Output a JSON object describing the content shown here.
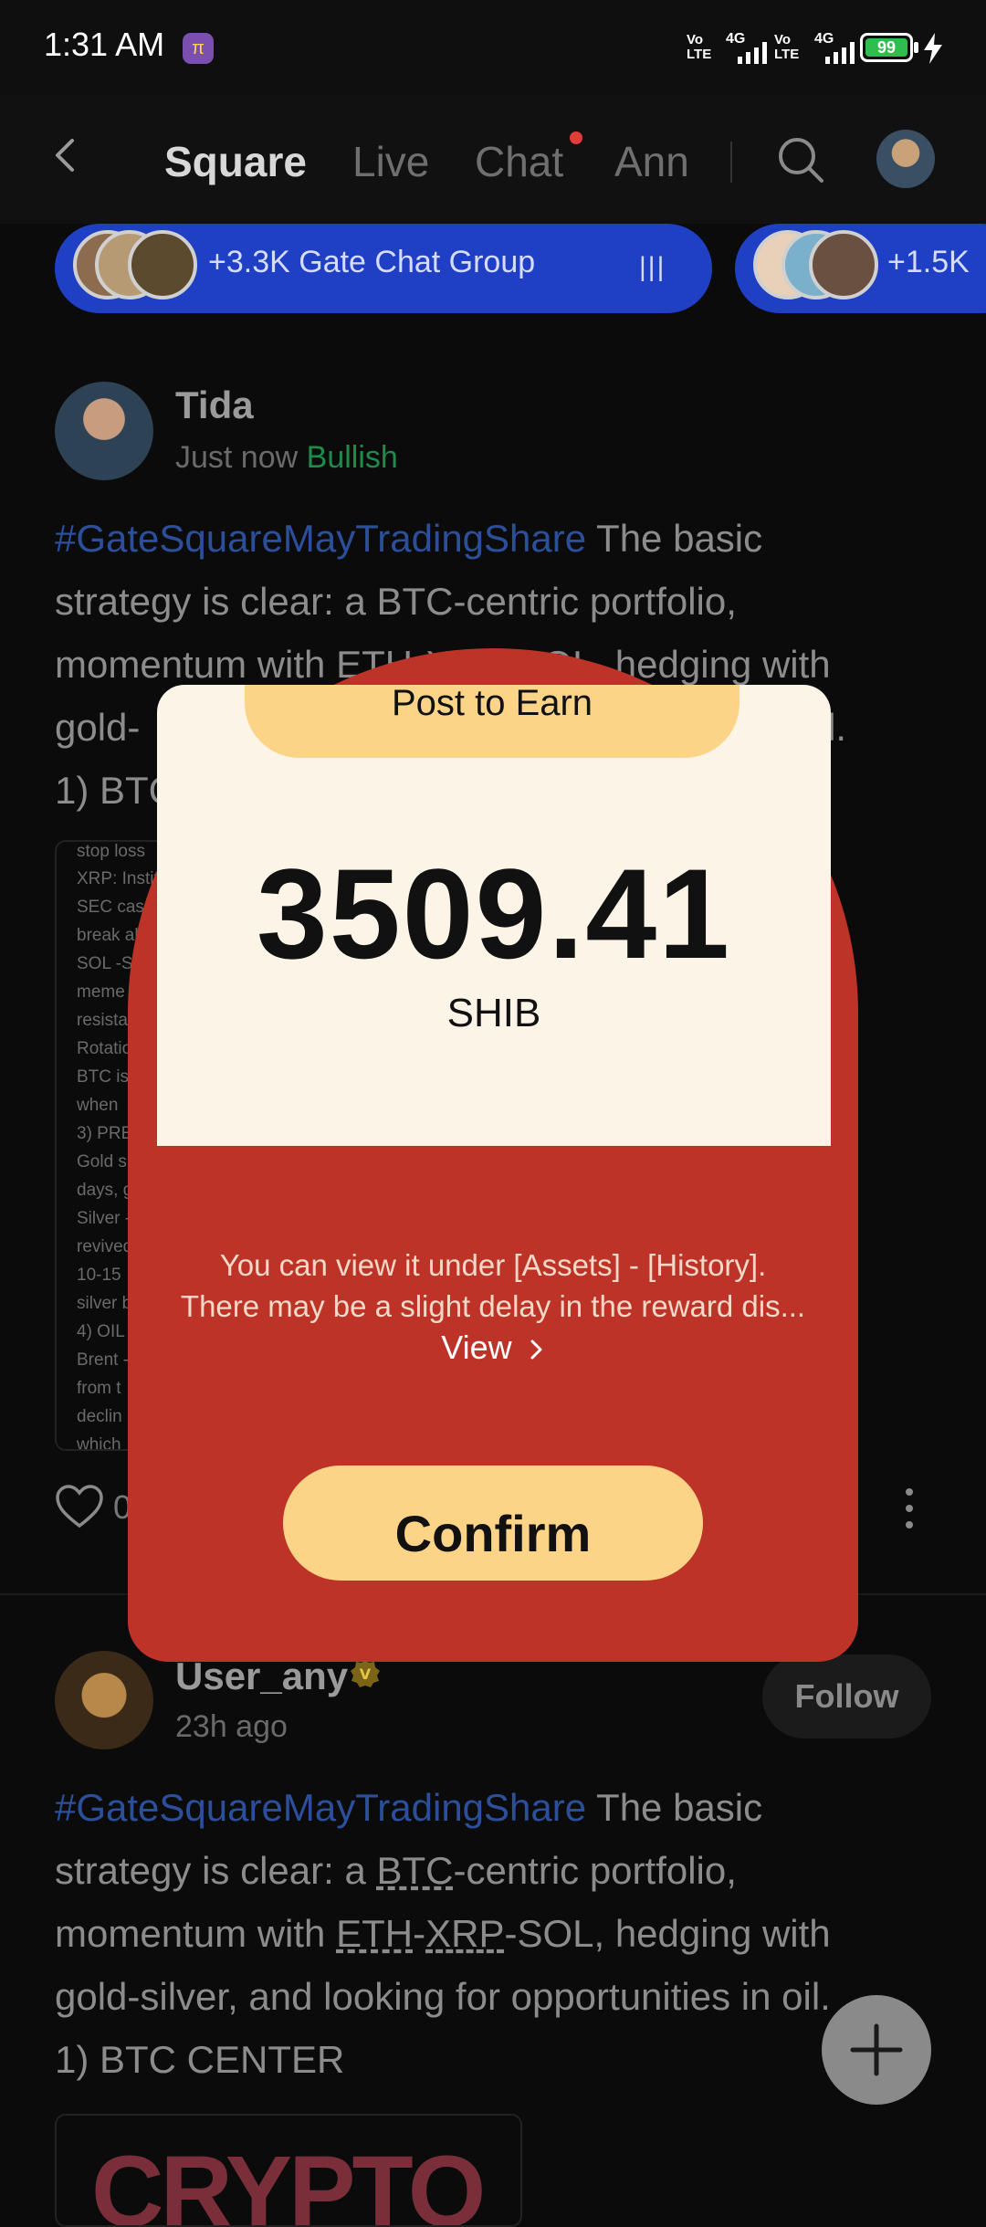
{
  "status_bar": {
    "time": "1:31 AM",
    "pi_icon": "pi-network-icon",
    "network1": "Vo LTE",
    "net1_type": "4G",
    "network2": "Vo LTE",
    "net2_type": "4G",
    "battery": "99"
  },
  "nav": {
    "tabs": [
      {
        "label": "Square"
      },
      {
        "label": "Live"
      },
      {
        "label": "Chat"
      },
      {
        "label": "Ann"
      }
    ]
  },
  "groups": [
    {
      "label": "+3.3K Gate Chat Group"
    },
    {
      "label": "+1.5K"
    }
  ],
  "post1": {
    "author": "Tida",
    "time": "Just now",
    "sentiment": "Bullish",
    "hashtag": "#GateSquareMayTradingShare",
    "text_lines": [
      "The basic",
      "strategy is clear: a BTC-centric portfolio,",
      "momentum with ETH-XRP-SOL, hedging with",
      "gold-",
      "oil.",
      "1) BTC"
    ],
    "embedded_lines": [
      "stop loss",
      "XRP: Instit",
      "SEC case",
      "break ab",
      "SOL -S",
      "meme",
      "resista",
      "Rotatio",
      "BTC is",
      "when",
      "3) PRE",
      "Gold s",
      "days, g",
      "Silver -",
      "revived",
      "10-15",
      "silver b",
      "4) OIL",
      "Brent -",
      "from t",
      "declin",
      "which"
    ],
    "like_count": "0"
  },
  "post2": {
    "author": "User_any",
    "time": "23h ago",
    "follow_label": "Follow",
    "hashtag": "#GateSquareMayTradingShare",
    "line1": " The basic",
    "line2_a": "strategy is clear: a ",
    "line2_btc": "BTC",
    "line2_b": "-centric portfolio,",
    "line3_a": "momentum with ",
    "line3_eth": "ETH",
    "line3_dash": "-",
    "line3_xrp": "XRP",
    "line3_b": "-SOL, hedging with",
    "line4": "gold-silver, and looking for opportunities in oil.",
    "line5": "1) BTC CENTER",
    "thumb_text": "CRYPTO"
  },
  "modal": {
    "title": "Post to Earn",
    "amount": "3509.41",
    "currency": "SHIB",
    "info1": "You can view it under [Assets] - [History].",
    "info2": "There may be a slight delay in the reward dis...",
    "view_label": "View",
    "confirm_label": "Confirm"
  },
  "colors": {
    "modal_red": "#bd3327",
    "card_cream": "#fdf4e8",
    "button_yellow": "#fcd488",
    "hashtag_blue": "#2c4f9c",
    "bullish_green": "#1f8b4a",
    "pill_blue": "#1f3fc4"
  }
}
